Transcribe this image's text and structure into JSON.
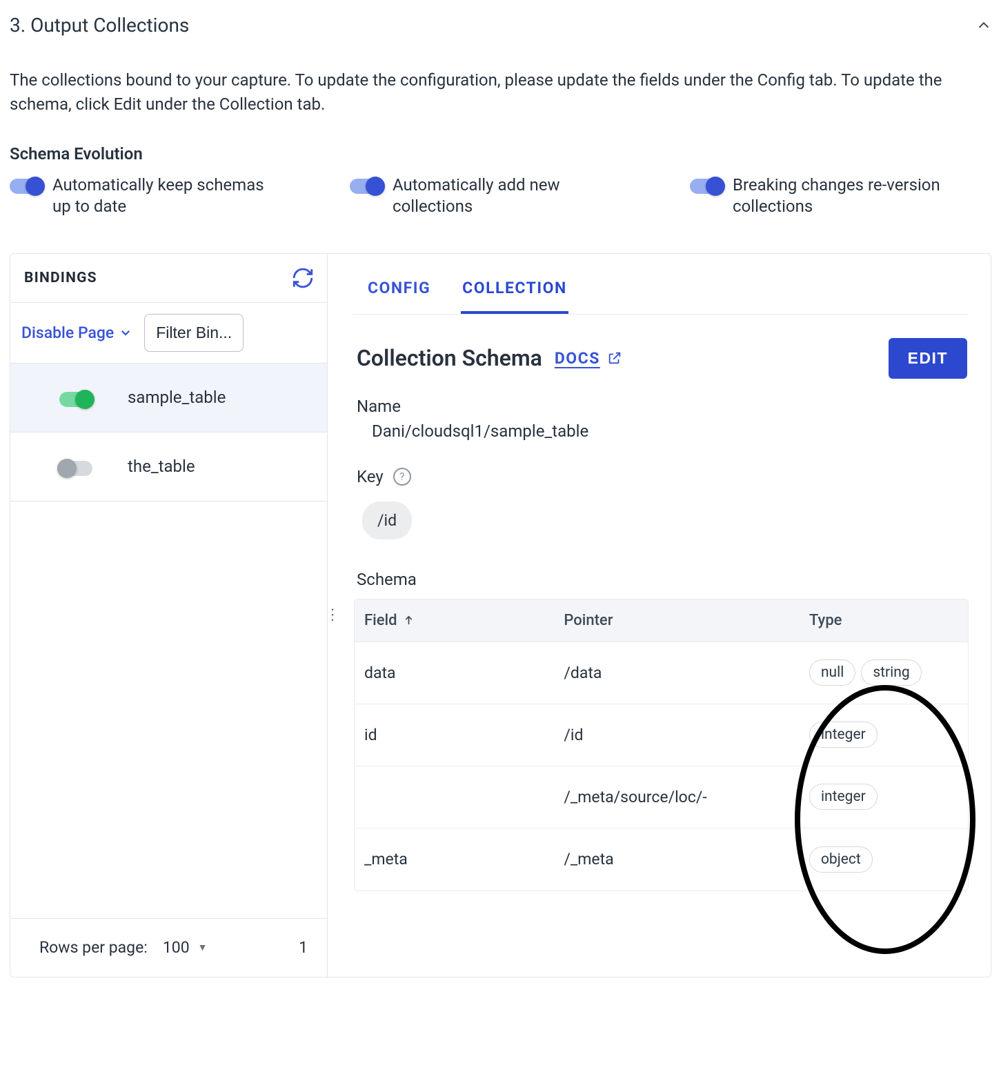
{
  "section_title": "3. Output Collections",
  "description": "The collections bound to your capture. To update the configuration, please update the fields under the Config tab. To update the schema, click Edit under the Collection tab.",
  "schema_evolution": {
    "heading": "Schema Evolution",
    "toggles": [
      {
        "label": "Automatically keep schemas up to date",
        "on": true
      },
      {
        "label": "Automatically add new collections",
        "on": true
      },
      {
        "label": "Breaking changes re-version collections",
        "on": true
      }
    ]
  },
  "bindings": {
    "header": "BINDINGS",
    "disable_page": "Disable Page",
    "filter_btn": "Filter Bin...",
    "items": [
      {
        "name": "sample_table",
        "on": true,
        "active": true
      },
      {
        "name": "the_table",
        "on": false,
        "active": false
      }
    ],
    "rows_per_page_label": "Rows per page:",
    "rows_per_page_value": "100",
    "page_indicator": "1"
  },
  "tabs": {
    "config": "CONFIG",
    "collection": "COLLECTION"
  },
  "collection": {
    "title": "Collection Schema",
    "docs": "DOCS",
    "edit": "EDIT",
    "name_label": "Name",
    "name_value": "Dani/cloudsql1/sample_table",
    "key_label": "Key",
    "key_chip": "/id",
    "schema_label": "Schema",
    "columns": {
      "field": "Field",
      "pointer": "Pointer",
      "type": "Type"
    },
    "rows": [
      {
        "field": "data",
        "pointer": "/data",
        "types": [
          "null",
          "string"
        ]
      },
      {
        "field": "id",
        "pointer": "/id",
        "types": [
          "integer"
        ]
      },
      {
        "field": "",
        "pointer": "/_meta/source/loc/-",
        "types": [
          "integer"
        ]
      },
      {
        "field": "_meta",
        "pointer": "/_meta",
        "types": [
          "object"
        ]
      }
    ]
  }
}
